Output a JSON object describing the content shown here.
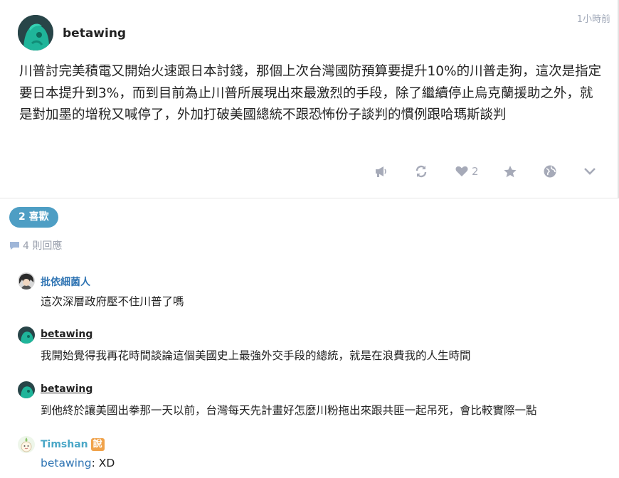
{
  "post": {
    "author": "betawing",
    "time": "1小時前",
    "text": "川普討完美積電又開始火速跟日本討錢，那個上次台灣國防預算要提升10%的川普走狗，這次是指定要日本提升到3%，而到目前為止川普所展現出來最激烈的手段，除了繼續停止烏克蘭援助之外，就是對加墨的增稅又喊停了，外加打破美國總統不跟恐怖份子談判的慣例跟哈瑪斯談判",
    "actions": {
      "like_count": "2",
      "icons": [
        "megaphone-icon",
        "repost-icon",
        "heart-icon",
        "star-icon",
        "globe-icon",
        "chevron-down-icon"
      ]
    }
  },
  "likes_label": "2 喜歡",
  "replies_label": "4 則回應",
  "comments": [
    {
      "name": "批依細菌人",
      "text": "這次深層政府壓不住川普了嗎"
    },
    {
      "name": "betawing",
      "text": "我開始覺得我再花時間談論這個美國史上最強外交手段的總統，就是在浪費我的人生時間"
    },
    {
      "name": "betawing",
      "text": "到他終於讓美國出拳那一天以前，台灣每天先計畫好怎麼川粉拖出來跟共匪一起吊死，會比較實際一點"
    },
    {
      "name": "Timshan",
      "badge": "說",
      "reply_to": "betawing",
      "separator": ":",
      "text": " XD"
    }
  ],
  "colors": {
    "accent": "#4e9ec4",
    "link": "#2f74b3",
    "icon_gray": "#a6aab8",
    "say_badge": "#f0a24a"
  }
}
